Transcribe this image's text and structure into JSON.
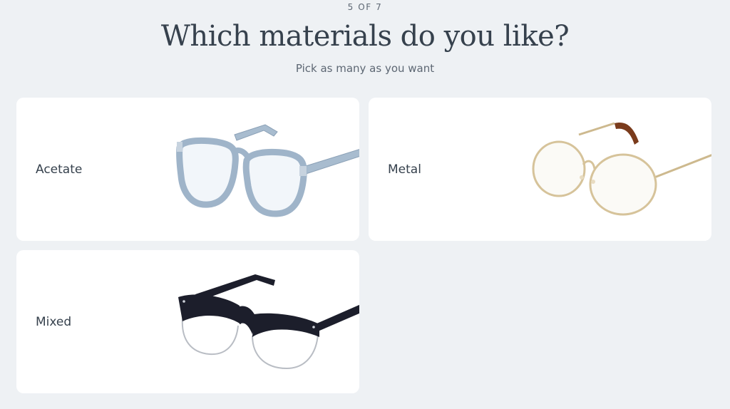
{
  "quiz": {
    "step": "5 OF 7",
    "title": "Which materials do you like?",
    "subtitle": "Pick as many as you want"
  },
  "options": [
    {
      "label": "Acetate",
      "image": "blue-acetate-glasses"
    },
    {
      "label": "Metal",
      "image": "gold-metal-round-glasses"
    },
    {
      "label": "Mixed",
      "image": "black-browline-glasses"
    }
  ],
  "colors": {
    "background": "#eef1f4",
    "card": "#ffffff",
    "text": "#36414d",
    "acetate_frame": "#9fb4c9",
    "metal_frame": "#d6c39a",
    "tortoise_tip": "#7a3b1c",
    "mixed_frame": "#1c1e2b"
  }
}
